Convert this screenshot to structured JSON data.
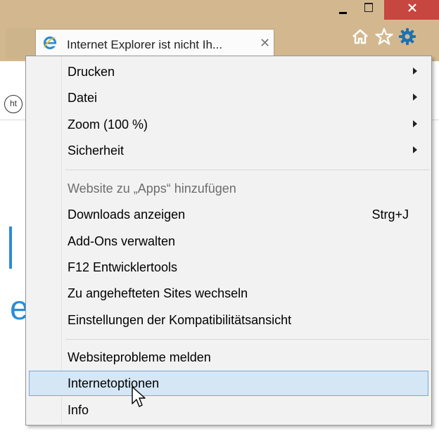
{
  "window": {
    "controls": {
      "minimize_icon": "minimize-icon",
      "maximize_icon": "maximize-icon",
      "close_icon": "close-icon"
    }
  },
  "tab": {
    "title": "Internet Explorer ist nicht Ih...",
    "close_glyph": "✕",
    "icon": "ie-logo-icon"
  },
  "toolbar": {
    "home_icon": "home-icon",
    "favorites_icon": "star-icon",
    "tools_icon": "gear-icon"
  },
  "page": {
    "ht_badge": "ht",
    "partial_glyph": "e"
  },
  "menu": {
    "items": [
      {
        "label": "Drucken",
        "submenu": true
      },
      {
        "label": "Datei",
        "submenu": true
      },
      {
        "label": "Zoom (100 %)",
        "submenu": true
      },
      {
        "label": "Sicherheit",
        "submenu": true
      },
      {
        "label": "Website zu „Apps“ hinzufügen",
        "disabled": true
      },
      {
        "label": "Downloads anzeigen",
        "shortcut": "Strg+J"
      },
      {
        "label": "Add-Ons verwalten"
      },
      {
        "label": "F12 Entwicklertools"
      },
      {
        "label": "Zu angehefteten Sites wechseln"
      },
      {
        "label": "Einstellungen der Kompatibilitätsansicht"
      },
      {
        "label": "Websiteprobleme melden"
      },
      {
        "label": "Internetoptionen",
        "highlighted": true
      },
      {
        "label": "Info"
      }
    ]
  },
  "colors": {
    "titlebar": "#d3b88f",
    "close_button": "#c7463f",
    "menu_bg": "#f2f2f2",
    "highlight_bg": "#d5e6f5",
    "highlight_border": "#7aa7d6",
    "ie_blue": "#2c8bd6",
    "gear_blue": "#1f6fb5"
  }
}
